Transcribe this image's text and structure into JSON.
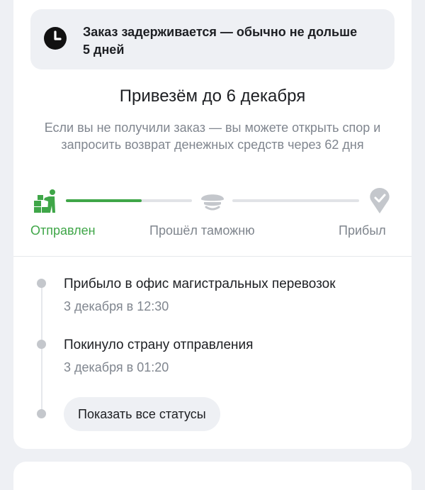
{
  "banner": {
    "icon": "clock-icon",
    "text": "Заказ задерживается — обычно не дольше 5 дней"
  },
  "delivery": {
    "headline": "Привезём до 6 декабря",
    "note": "Если вы не получили заказ — вы можете открыть спор и запросить возврат денежных средств через 62 дня"
  },
  "progress": {
    "steps": [
      {
        "label": "Отправлен",
        "icon": "sent-worker-boxes-icon",
        "status": "active"
      },
      {
        "label": "Прошёл таможню",
        "icon": "customs-cap-icon",
        "status": "pending"
      },
      {
        "label": "Прибыл",
        "icon": "location-check-icon",
        "status": "pending"
      }
    ],
    "segment_fill": 0.6,
    "colors": {
      "active": "#3fa648",
      "pending": "#c4c7cc"
    }
  },
  "timeline": {
    "events": [
      {
        "title": "Прибыло в офис магистральных перевозок",
        "time": "3 декабря в 12:30"
      },
      {
        "title": "Покинуло страну отправления",
        "time": "3 декабря в 01:20"
      }
    ],
    "show_all_label": "Показать все статусы"
  }
}
